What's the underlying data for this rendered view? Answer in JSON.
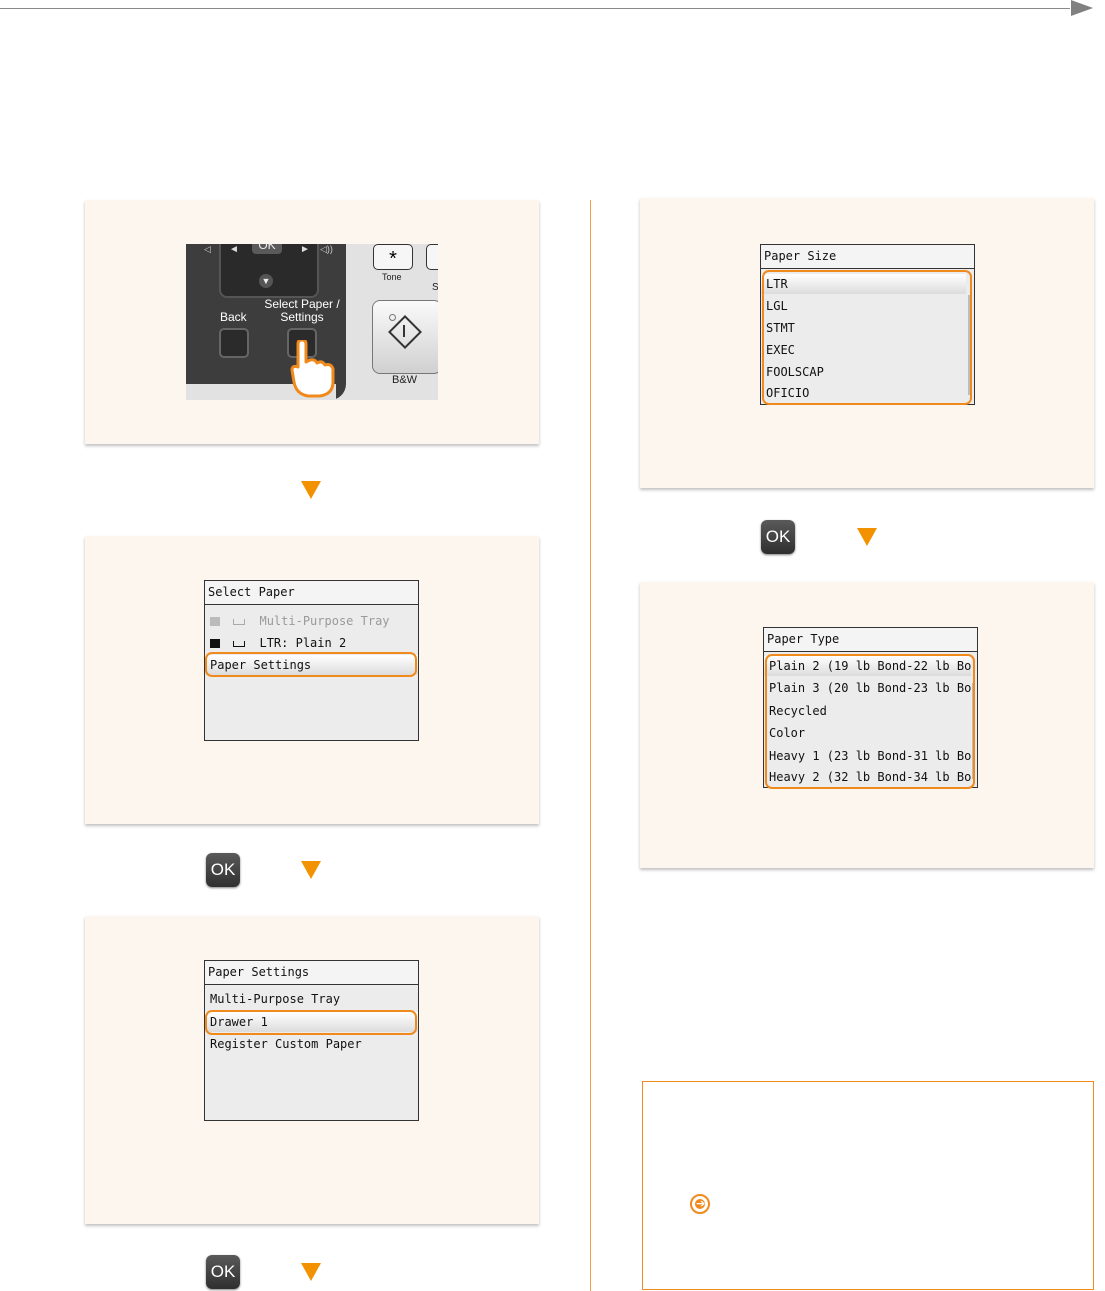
{
  "control_panel": {
    "ok_label": "OK",
    "back_label": "Back",
    "select_label_line1": "Select Paper /",
    "select_label_line2": "Settings",
    "tone_key": "*",
    "tone_label": "Tone",
    "bw_label": "B&W",
    "partial_label": "S"
  },
  "select_paper_screen": {
    "title": "Select Paper",
    "rows": [
      "Multi-Purpose Tray",
      "LTR: Plain 2",
      "Paper Settings"
    ]
  },
  "paper_settings_screen": {
    "title": "Paper Settings",
    "rows": [
      "Multi-Purpose Tray",
      "Drawer 1",
      "Register Custom Paper"
    ]
  },
  "paper_size_screen": {
    "title": "Paper Size",
    "rows": [
      "LTR",
      "LGL",
      "STMT",
      "EXEC",
      "FOOLSCAP",
      "OFICIO"
    ]
  },
  "paper_type_screen": {
    "title": "Paper Type",
    "rows": [
      "Plain 2 (19 lb Bond-22 lb Bo…",
      "Plain 3 (20 lb Bond-23 lb Bo…",
      "Recycled",
      "Color",
      "Heavy 1 (23 lb Bond-31 lb Bo…",
      "Heavy 2 (32 lb Bond-34 lb Bo…"
    ]
  },
  "buttons": {
    "ok": "OK"
  },
  "colors": {
    "accent": "#f39200",
    "panel_bg": "#fdf6ef",
    "lcd_bg": "#ececec"
  },
  "icons": [
    "arrow-right-icon",
    "down-arrow-icon",
    "ok-key-icon",
    "link-arrow-icon",
    "hand-pointer-icon",
    "start-icon"
  ]
}
